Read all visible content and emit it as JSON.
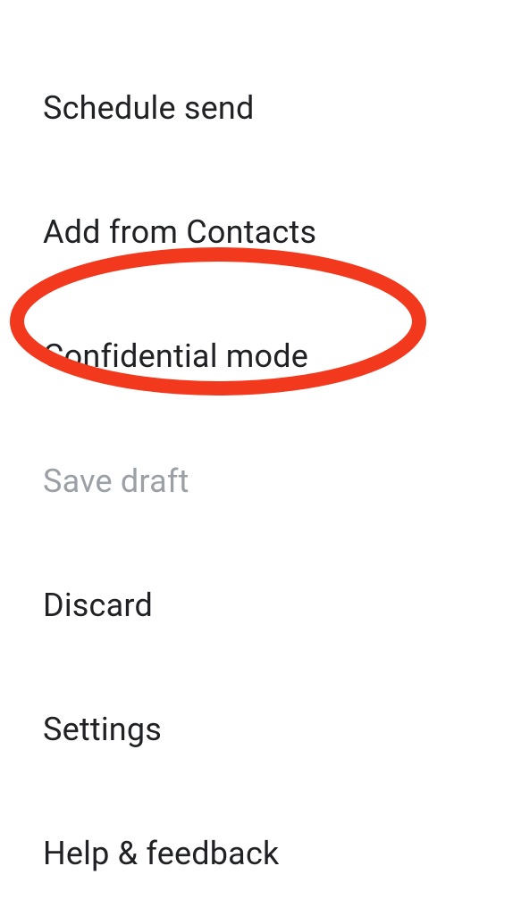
{
  "menu": {
    "items": [
      {
        "label": "Schedule send",
        "enabled": true
      },
      {
        "label": "Add from Contacts",
        "enabled": true
      },
      {
        "label": "Confidential mode",
        "enabled": true,
        "highlighted": true
      },
      {
        "label": "Save draft",
        "enabled": false
      },
      {
        "label": "Discard",
        "enabled": true
      },
      {
        "label": "Settings",
        "enabled": true
      },
      {
        "label": "Help & feedback",
        "enabled": true
      }
    ]
  },
  "annotation": {
    "color": "#f2391d"
  }
}
